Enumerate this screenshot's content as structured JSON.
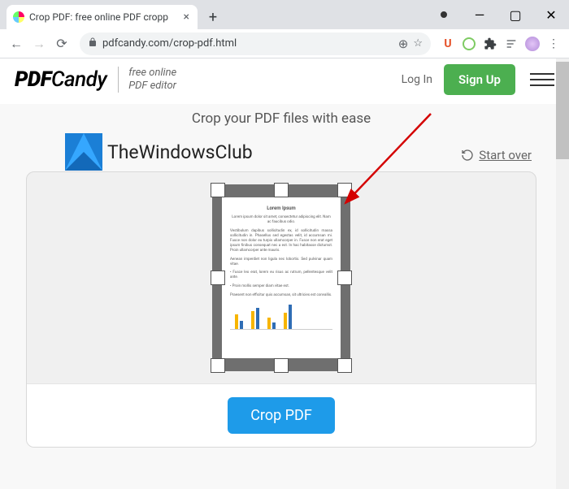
{
  "browser": {
    "tab_title": "Crop PDF: free online PDF cropp",
    "url": "pdfcandy.com/crop-pdf.html",
    "window": {
      "min": "—",
      "max": "▢",
      "close": "✕"
    }
  },
  "toolbar_icons": {
    "back": "←",
    "fwd": "→",
    "reload": "⟳",
    "lock": "🔒",
    "search": "⊕",
    "star": "☆",
    "u": "U",
    "puzzle": "✦",
    "lines": "≡",
    "menu": "⋮"
  },
  "header": {
    "logo_pdf": "PDF",
    "logo_candy": "Candy",
    "tagline_l1": "free online",
    "tagline_l2": "PDF editor",
    "login": "Log In",
    "signup": "Sign Up"
  },
  "page": {
    "title": "Crop your PDF files with ease",
    "startover": "Start over",
    "crop_button": "Crop PDF",
    "watermark": "TheWindowsClub"
  },
  "doc_preview": {
    "heading": "Lorem Ipsum",
    "subheading": "Lorem ipsum dolor sit amet, consectetur adipiscing elit. Nam ac faucibus odio."
  },
  "colors": {
    "green": "#4CAF50",
    "blue_btn": "#1e9be9",
    "frame_grey": "#6f6f6f"
  }
}
